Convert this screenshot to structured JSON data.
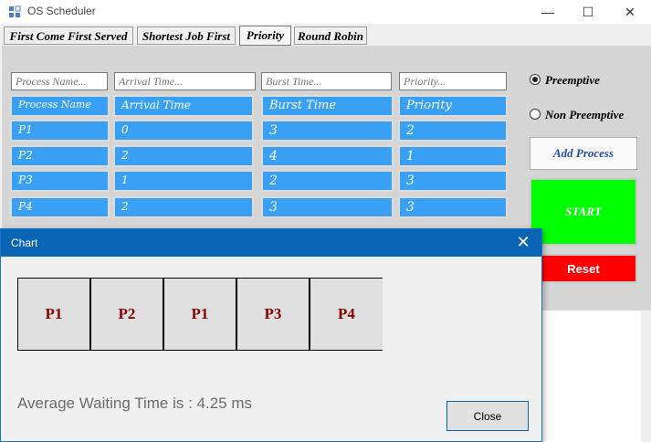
{
  "window": {
    "title": "OS Scheduler",
    "controls": {
      "minimize": "—",
      "maximize": "☐",
      "close": "✕"
    }
  },
  "tabs": [
    {
      "label": "First Come First Served",
      "active": false
    },
    {
      "label": "Shortest Job First",
      "active": false
    },
    {
      "label": "Priority",
      "active": true
    },
    {
      "label": "Round Robin",
      "active": false
    }
  ],
  "inputs": {
    "process_name": {
      "placeholder": "Process Name...",
      "value": ""
    },
    "arrival_time": {
      "placeholder": "Arrival Time...",
      "value": ""
    },
    "burst_time": {
      "placeholder": "Burst Time...",
      "value": ""
    },
    "priority": {
      "placeholder": "Priority...",
      "value": ""
    }
  },
  "table": {
    "headers": [
      "Process Name",
      "Arrival Time",
      "Burst Time",
      "Priority"
    ],
    "rows": [
      [
        "P1",
        "0",
        "3",
        "2"
      ],
      [
        "P2",
        "2",
        "4",
        "1"
      ],
      [
        "P3",
        "1",
        "2",
        "3"
      ],
      [
        "P4",
        "2",
        "3",
        "3"
      ]
    ]
  },
  "options": {
    "preemptive": {
      "label": "Preemptive",
      "selected": true
    },
    "non_preemptive": {
      "label": "Non Preemptive",
      "selected": false
    }
  },
  "buttons": {
    "add_process": "Add Process",
    "start": "START",
    "reset": "Reset"
  },
  "colors": {
    "cell_blue": "#3aa0f3",
    "start_green": "#00ff00",
    "reset_red": "#ff0000",
    "dialog_title_blue": "#0a64b4",
    "gantt_text": "#8b0000"
  },
  "dialog": {
    "title": "Chart",
    "close_x": "✕",
    "gantt": [
      "P1",
      "P2",
      "P1",
      "P3",
      "P4"
    ],
    "average_waiting_time": "Average Waiting Time is : 4.25 ms",
    "close_label": "Close"
  }
}
